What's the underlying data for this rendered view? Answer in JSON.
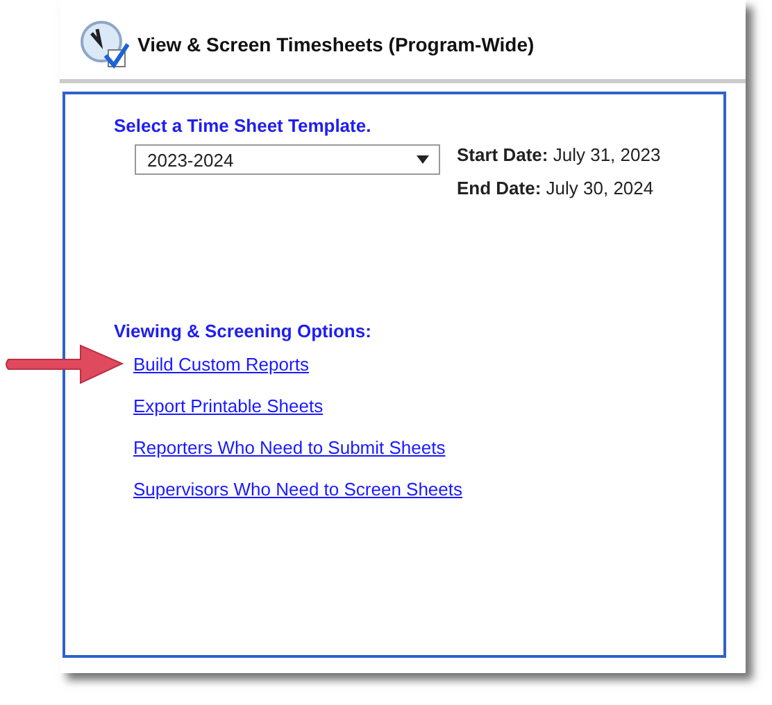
{
  "header": {
    "title": "View & Screen Timesheets (Program-Wide)"
  },
  "template": {
    "heading": "Select a Time Sheet Template.",
    "value": "2023-2024"
  },
  "dates": [
    {
      "label": "Start Date:",
      "value": "July 31, 2023"
    },
    {
      "label": "End Date:",
      "value": "July 30, 2024"
    }
  ],
  "options": {
    "heading": "Viewing & Screening Options:",
    "links": [
      {
        "label": "Build Custom Reports",
        "pointed": true
      },
      {
        "label": "Export Printable Sheets",
        "pointed": false
      },
      {
        "label": "Reporters Who Need to Submit Sheets",
        "pointed": false
      },
      {
        "label": "Supervisors Who Need to Screen Sheets",
        "pointed": false
      }
    ]
  }
}
